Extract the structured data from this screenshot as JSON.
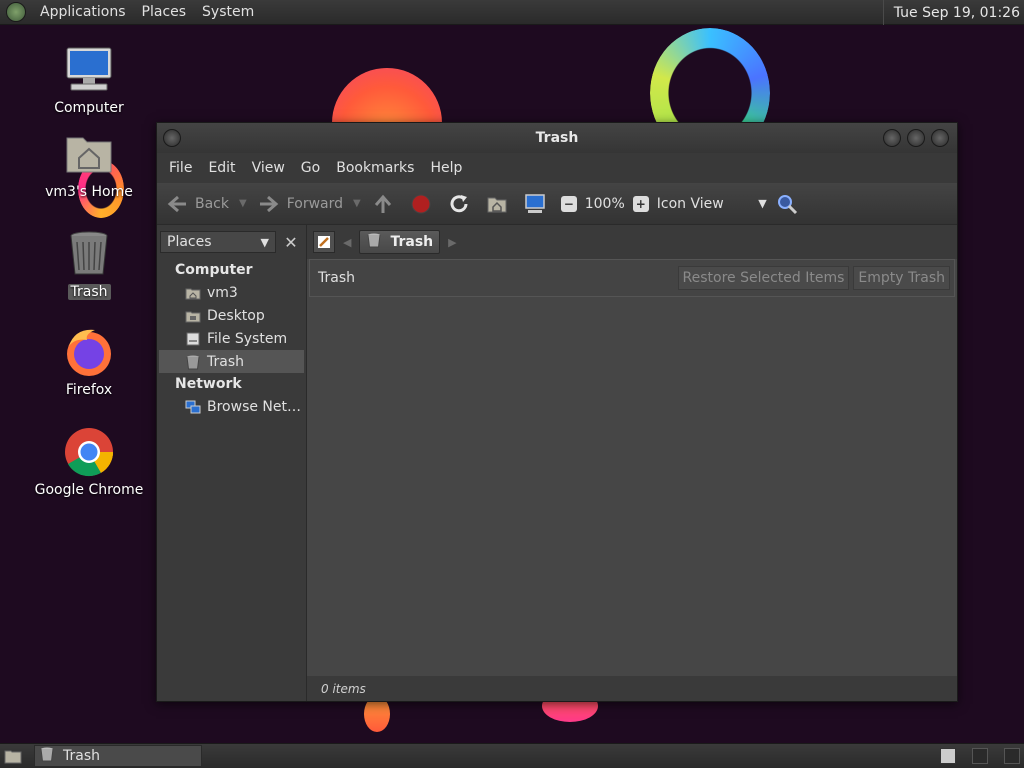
{
  "top_panel": {
    "menus": [
      "Applications",
      "Places",
      "System"
    ],
    "clock": "Tue Sep 19, 01:26"
  },
  "desktop_icons": [
    {
      "label": "Computer",
      "icon": "computer-icon"
    },
    {
      "label": "vm3's Home",
      "icon": "home-folder-icon"
    },
    {
      "label": "Trash",
      "icon": "trash-icon",
      "selected": true
    },
    {
      "label": "Firefox",
      "icon": "firefox-icon"
    },
    {
      "label": "Google Chrome",
      "icon": "chrome-icon"
    }
  ],
  "window": {
    "title": "Trash",
    "menubar": [
      "File",
      "Edit",
      "View",
      "Go",
      "Bookmarks",
      "Help"
    ],
    "toolbar": {
      "back": "Back",
      "forward": "Forward",
      "zoom": "100%",
      "view_mode": "Icon View"
    },
    "sidebar": {
      "selector": "Places",
      "groups": [
        {
          "name": "Computer",
          "items": [
            {
              "label": "vm3",
              "icon": "home-icon"
            },
            {
              "label": "Desktop",
              "icon": "desktop-folder-icon"
            },
            {
              "label": "File System",
              "icon": "drive-icon"
            },
            {
              "label": "Trash",
              "icon": "trash-icon",
              "selected": true
            }
          ]
        },
        {
          "name": "Network",
          "items": [
            {
              "label": "Browse Net…",
              "icon": "network-icon"
            }
          ]
        }
      ]
    },
    "pathbar": {
      "crumb": "Trash"
    },
    "trash_bar": {
      "title": "Trash",
      "restore": "Restore Selected Items",
      "empty": "Empty Trash"
    },
    "status": "0 items"
  },
  "bottom_panel": {
    "task": "Trash"
  },
  "colors": {
    "desktop_bg": "#1e0a20",
    "window_bg": "#3a3a3a",
    "content_bg": "#464646"
  }
}
